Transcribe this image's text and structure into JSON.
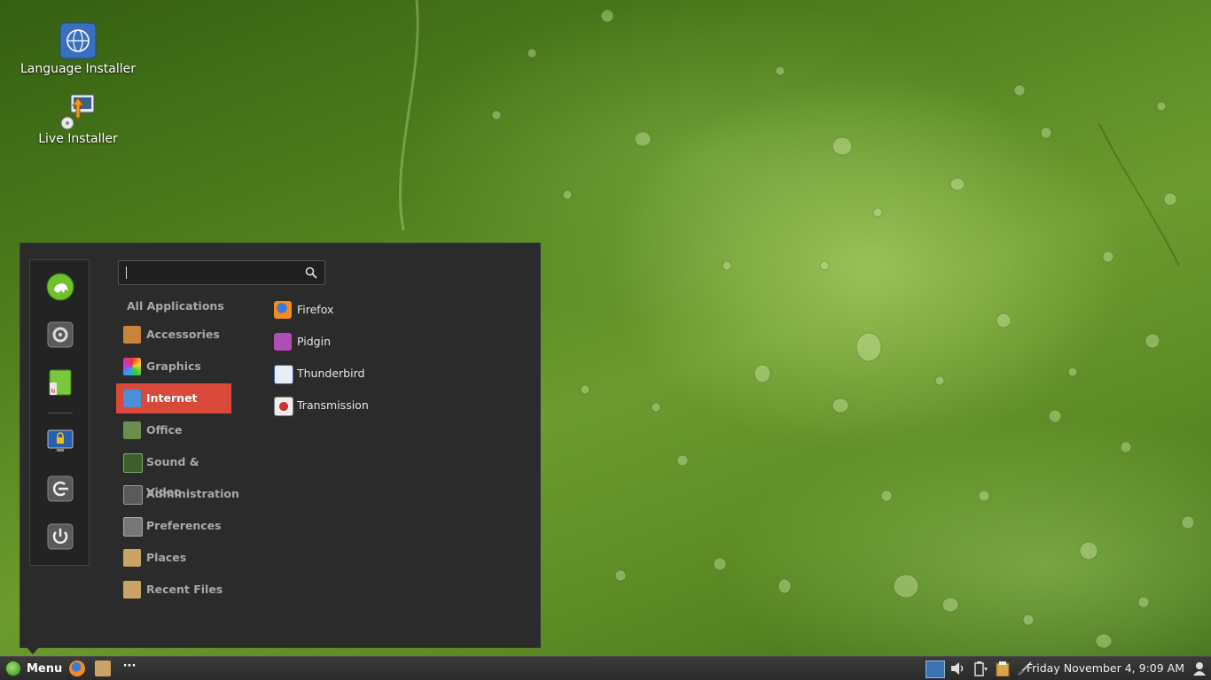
{
  "desktop": {
    "icons": [
      {
        "label": "Language Installer",
        "icon": "globe-icon"
      },
      {
        "label": "Live Installer",
        "icon": "installer-icon"
      }
    ]
  },
  "menu": {
    "favorites": [
      "system-monitor-icon",
      "settings-icon",
      "notes-icon",
      "lock-screen-icon",
      "logout-icon",
      "power-icon"
    ],
    "search": {
      "value": "",
      "placeholder": ""
    },
    "categories": [
      {
        "label": "All Applications",
        "icon": ""
      },
      {
        "label": "Accessories",
        "icon": "accessories-icon"
      },
      {
        "label": "Graphics",
        "icon": "graphics-icon"
      },
      {
        "label": "Internet",
        "icon": "internet-icon",
        "selected": true
      },
      {
        "label": "Office",
        "icon": "office-icon"
      },
      {
        "label": "Sound & Video",
        "icon": "sound-video-icon"
      },
      {
        "label": "Administration",
        "icon": "administration-icon"
      },
      {
        "label": "Preferences",
        "icon": "preferences-icon"
      },
      {
        "label": "Places",
        "icon": "folder-icon"
      },
      {
        "label": "Recent Files",
        "icon": "recent-files-icon"
      }
    ],
    "apps": [
      {
        "label": "Firefox",
        "icon": "firefox-icon"
      },
      {
        "label": "Pidgin",
        "icon": "pidgin-icon"
      },
      {
        "label": "Thunderbird",
        "icon": "thunderbird-icon"
      },
      {
        "label": "Transmission",
        "icon": "transmission-icon"
      }
    ]
  },
  "taskbar": {
    "menu_label": "Menu",
    "launchers": [
      "firefox-icon",
      "files-icon",
      "more-icon"
    ],
    "more_label": "···",
    "tray": [
      "workspace-icon",
      "volume-icon",
      "battery-icon",
      "clipboard-icon",
      "network-icon",
      "user-icon"
    ],
    "clock": "Friday November  4,  9:09 AM"
  },
  "colors": {
    "accent": "#d9493a",
    "menu_bg": "#2b2b2b",
    "taskbar_bg": "#2f2f2f"
  }
}
